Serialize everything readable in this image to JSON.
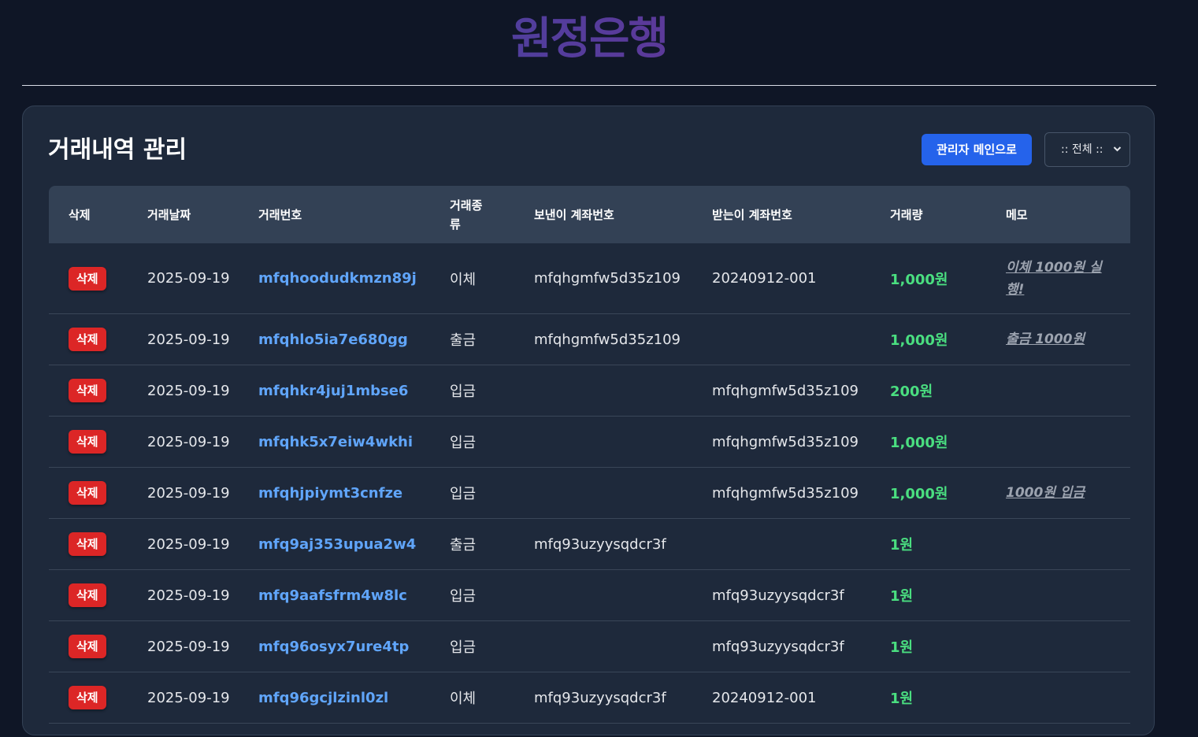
{
  "header": {
    "brand": "원정은행"
  },
  "panel": {
    "title": "거래내역 관리",
    "admin_button": "관리자 메인으로",
    "filter": {
      "selected": ":: 전체 ::"
    }
  },
  "table": {
    "headers": {
      "delete": "삭제",
      "date": "거래날짜",
      "txid": "거래번호",
      "type_line1": "거래종",
      "type_line2": "류",
      "sender": "보낸이 계좌번호",
      "receiver": "받는이 계좌번호",
      "amount": "거래량",
      "memo": "메모"
    },
    "rows": [
      {
        "delete": "삭제",
        "date": "2025-09-19",
        "txid": "mfqhoodudkmzn89j",
        "type": "이체",
        "sender": "mfqhgmfw5d35z109",
        "receiver": "20240912-001",
        "amount": "1,000원",
        "memo_line1": "이체 1000원 실",
        "memo_line2": "행!"
      },
      {
        "delete": "삭제",
        "date": "2025-09-19",
        "txid": "mfqhlo5ia7e680gg",
        "type": "출금",
        "sender": "mfqhgmfw5d35z109",
        "receiver": "",
        "amount": "1,000원",
        "memo_line1": "출금 1000원",
        "memo_line2": ""
      },
      {
        "delete": "삭제",
        "date": "2025-09-19",
        "txid": "mfqhkr4juj1mbse6",
        "type": "입금",
        "sender": "",
        "receiver": "mfqhgmfw5d35z109",
        "amount": "200원",
        "memo_line1": "",
        "memo_line2": ""
      },
      {
        "delete": "삭제",
        "date": "2025-09-19",
        "txid": "mfqhk5x7eiw4wkhi",
        "type": "입금",
        "sender": "",
        "receiver": "mfqhgmfw5d35z109",
        "amount": "1,000원",
        "memo_line1": "",
        "memo_line2": ""
      },
      {
        "delete": "삭제",
        "date": "2025-09-19",
        "txid": "mfqhjpiymt3cnfze",
        "type": "입금",
        "sender": "",
        "receiver": "mfqhgmfw5d35z109",
        "amount": "1,000원",
        "memo_line1": "1000원 입금",
        "memo_line2": ""
      },
      {
        "delete": "삭제",
        "date": "2025-09-19",
        "txid": "mfq9aj353upua2w4",
        "type": "출금",
        "sender": "mfq93uzyysqdcr3f",
        "receiver": "",
        "amount": "1원",
        "memo_line1": "",
        "memo_line2": ""
      },
      {
        "delete": "삭제",
        "date": "2025-09-19",
        "txid": "mfq9aafsfrm4w8lc",
        "type": "입금",
        "sender": "",
        "receiver": "mfq93uzyysqdcr3f",
        "amount": "1원",
        "memo_line1": "",
        "memo_line2": ""
      },
      {
        "delete": "삭제",
        "date": "2025-09-19",
        "txid": "mfq96osyx7ure4tp",
        "type": "입금",
        "sender": "",
        "receiver": "mfq93uzyysqdcr3f",
        "amount": "1원",
        "memo_line1": "",
        "memo_line2": ""
      },
      {
        "delete": "삭제",
        "date": "2025-09-19",
        "txid": "mfq96gcjlzinl0zl",
        "type": "이체",
        "sender": "mfq93uzyysqdcr3f",
        "receiver": "20240912-001",
        "amount": "1원",
        "memo_line1": "",
        "memo_line2": ""
      }
    ]
  },
  "colors": {
    "page_bg": "#0f1626",
    "panel_bg": "#1e293b",
    "header_bg": "#334155",
    "primary_button": "#2563eb",
    "delete_button": "#dc2626",
    "link": "#60a5fa",
    "amount": "#4ade80"
  }
}
